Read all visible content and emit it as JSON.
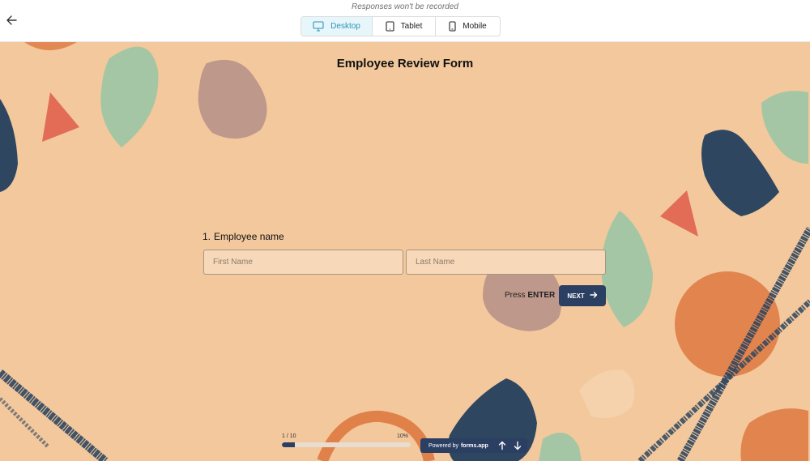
{
  "header": {
    "notice": "Responses won't be recorded",
    "devices": [
      {
        "label": "Desktop",
        "icon": "monitor-icon",
        "active": true
      },
      {
        "label": "Tablet",
        "icon": "tablet-icon",
        "active": false
      },
      {
        "label": "Mobile",
        "icon": "phone-icon",
        "active": false
      }
    ]
  },
  "form": {
    "title": "Employee Review Form",
    "question": {
      "number": "1.",
      "label": "Employee name",
      "first_placeholder": "First Name",
      "last_placeholder": "Last Name"
    },
    "press_hint": "Press",
    "press_key": "ENTER",
    "next_label": "NEXT"
  },
  "progress": {
    "step": "1 / 10",
    "percent_label": "10%",
    "fraction": 0.1
  },
  "footer": {
    "powered_by": "Powered by",
    "brand": "forms.app"
  },
  "colors": {
    "background": "#f2c89c",
    "accent": "#2b3f63",
    "active_device": "#2f93b8"
  }
}
